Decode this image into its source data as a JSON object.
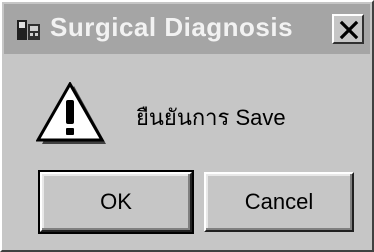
{
  "dialog": {
    "title": "Surgical Diagnosis",
    "message": "ยืนยันการ Save",
    "icons": {
      "app": "app-icon",
      "close": "close-icon",
      "warning": "warning-icon"
    }
  },
  "buttons": {
    "ok_label": "OK",
    "cancel_label": "Cancel"
  },
  "colors": {
    "face": "#c6c6c6",
    "titlebar_inactive": "#a5a5a5",
    "title_text": "#f2f2f2"
  }
}
